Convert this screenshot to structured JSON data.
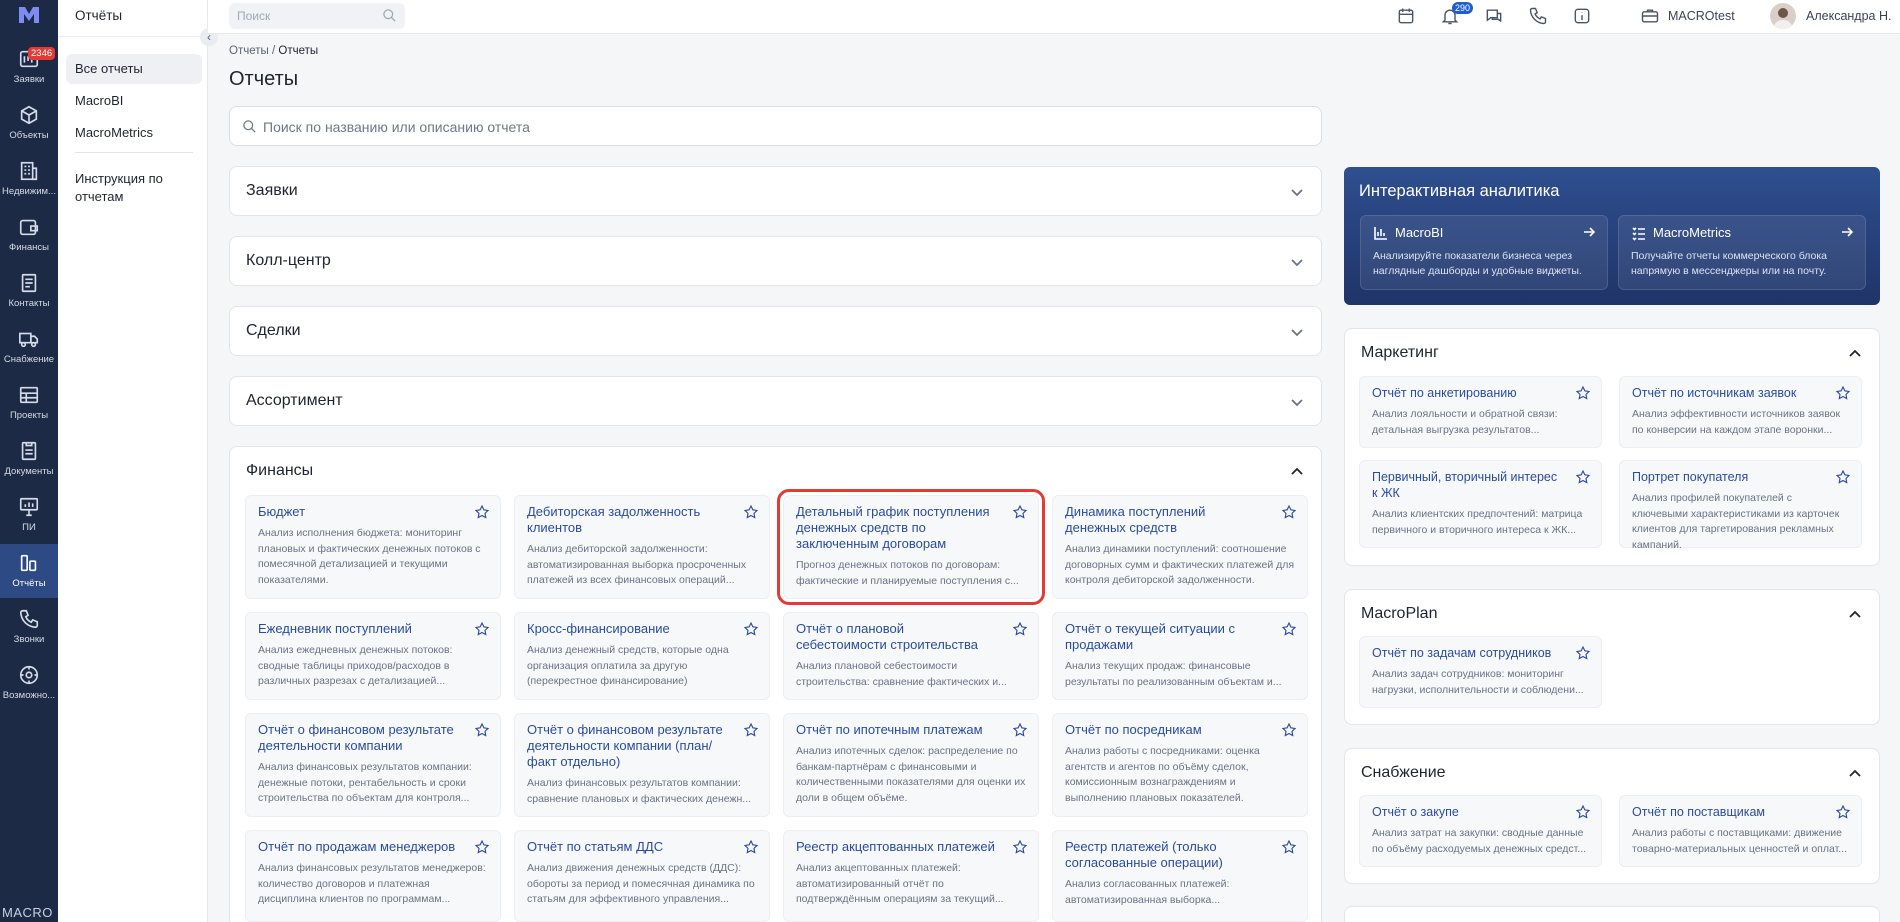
{
  "rail": {
    "items": [
      {
        "label": "Заявки",
        "badge": "2346",
        "icon": "requests-icon"
      },
      {
        "label": "Объекты",
        "icon": "cube-icon"
      },
      {
        "label": "Недвижим...",
        "icon": "building-icon"
      },
      {
        "label": "Финансы",
        "icon": "wallet-icon"
      },
      {
        "label": "Контакты",
        "icon": "contacts-icon"
      },
      {
        "label": "Снабжение",
        "icon": "truck-icon"
      },
      {
        "label": "Проекты",
        "icon": "projects-icon"
      },
      {
        "label": "Документы",
        "icon": "document-icon"
      },
      {
        "label": "ПИ",
        "icon": "presentation-icon"
      },
      {
        "label": "Отчёты",
        "icon": "reports-icon",
        "active": true
      },
      {
        "label": "Звонки",
        "icon": "phone-icon"
      },
      {
        "label": "Возможно...",
        "icon": "settings-icon"
      }
    ],
    "brand": "MACRO"
  },
  "sidebar": {
    "title": "Отчёты",
    "items": [
      "Все отчеты",
      "MacroBI",
      "MacroMetrics"
    ],
    "extra": "Инструкция по отчетам"
  },
  "topbar": {
    "search_placeholder": "Поиск",
    "notif_count": "290",
    "org": "MACROtest",
    "user": "Александра Н."
  },
  "breadcrumb": {
    "root": "Отчеты",
    "sep": "/",
    "current": "Отчеты"
  },
  "page_title": "Отчеты",
  "report_search_placeholder": "Поиск по названию или описанию отчета",
  "accordions": [
    "Заявки",
    "Колл-центр",
    "Сделки",
    "Ассортимент"
  ],
  "finance": {
    "title": "Финансы",
    "cards": [
      {
        "title": "Бюджет",
        "desc": "Анализ исполнения бюджета: мониторинг плановых и фактических денежных потоков с помесячной детализацией и текущими показателями."
      },
      {
        "title": "Дебиторская задолженность клиентов",
        "desc": "Анализ дебиторской задолженности: автоматизированная выборка просроченных платежей из всех финансовых операций..."
      },
      {
        "title": "Детальный график поступления денежных средств по заключенным договорам",
        "desc": "Прогноз денежных потоков по договорам: фактические и планируемые поступления с..."
      },
      {
        "title": "Динамика поступлений денежных средств",
        "desc": "Анализ динамики поступлений: соотношение договорных сумм и фактических платежей для контроля дебиторской задолженности."
      },
      {
        "title": "Ежедневник поступлений",
        "desc": "Анализ ежедневных денежных потоков: сводные таблицы приходов/расходов в различных разрезах с детализацией..."
      },
      {
        "title": "Кросс-финансирование",
        "desc": "Анализ денежный средств, которые одна организация оплатила за другую (перекрестное финансирование)"
      },
      {
        "title": "Отчёт о плановой себестоимости строительства",
        "desc": "Анализ плановой себестоимости строительства: сравнение фактических и..."
      },
      {
        "title": "Отчёт о текущей ситуации с продажами",
        "desc": "Анализ текущих продаж: финансовые результаты по реализованным объектам и..."
      },
      {
        "title": "Отчёт о финансовом результате деятельности компании",
        "desc": "Анализ финансовых результатов компании: денежные потоки, рентабельность и сроки строительства по объектам для контроля..."
      },
      {
        "title": "Отчёт о финансовом результате деятельности компании (план/факт отдельно)",
        "desc": "Анализ финансовых результатов компании: сравнение плановых и фактических денежн..."
      },
      {
        "title": "Отчёт по ипотечным платежам",
        "desc": "Анализ ипотечных сделок: распределение по банкам-партнёрам с финансовыми и количественными показателями для оценки их доли в общем объёме."
      },
      {
        "title": "Отчёт по посредникам",
        "desc": "Анализ работы с посредниками: оценка агентств и агентов по объёму сделок, комиссионным вознаграждениям и выполнению плановых показателей."
      },
      {
        "title": "Отчёт по продажам менеджеров",
        "desc": "Анализ финансовых результатов менеджеров: количество договоров и платежная дисциплина клиентов по программам..."
      },
      {
        "title": "Отчёт по статьям ДДС",
        "desc": "Анализ движения денежных средств (ДДС): обороты за период и помесячная динамика по статьям для эффективного управления..."
      },
      {
        "title": "Реестр акцептованных платежей",
        "desc": "Анализ акцептованных платежей: автоматизированный отчёт по подтверждённым операциям за текущий..."
      },
      {
        "title": "Реестр платежей (только согласованные операции)",
        "desc": "Анализ согласованных платежей: автоматизированная выборка..."
      }
    ]
  },
  "analytics": {
    "title": "Интерактивная аналитика",
    "items": [
      {
        "name": "MacroBI",
        "desc": "Анализируйте показатели бизнеса через наглядные дашборды и удобные виджеты."
      },
      {
        "name": "MacroMetrics",
        "desc": "Получайте отчеты коммерческого блока напрямую в мессенджеры или на почту."
      }
    ]
  },
  "marketing": {
    "title": "Маркетинг",
    "cards": [
      {
        "title": "Отчёт по анкетированию",
        "desc": "Анализ лояльности и обратной связи: детальная выгрузка результатов..."
      },
      {
        "title": "Отчёт по источникам заявок",
        "desc": "Анализ эффективности источников заявок по конверсии на каждом этапе воронки..."
      },
      {
        "title": "Первичный, вторичный интерес к ЖК",
        "desc": "Анализ клиентских предпочтений: матрица первичного и вторичного интереса к ЖК..."
      },
      {
        "title": "Портрет покупателя",
        "desc": "Анализ профилей покупателей с ключевыми характеристиками из карточек клиентов для таргетирования рекламных кампаний."
      }
    ]
  },
  "macroplan": {
    "title": "MacroPlan",
    "cards": [
      {
        "title": "Отчёт по задачам сотрудников",
        "desc": "Анализ задач сотрудников: мониторинг нагрузки, исполнительности и соблюдени..."
      }
    ]
  },
  "supply": {
    "title": "Снабжение",
    "cards": [
      {
        "title": "Отчёт о закупе",
        "desc": "Анализ затрат на закупки: сводные данные по объёму расходуемых денежных средст..."
      },
      {
        "title": "Отчёт по поставщикам",
        "desc": "Анализ работы с поставщиками: движение товарно-материальных ценностей и оплат..."
      }
    ]
  },
  "colors": {
    "accent": "#2a4c9e",
    "rail": "#1c2a45",
    "highlight": "#e53935"
  }
}
